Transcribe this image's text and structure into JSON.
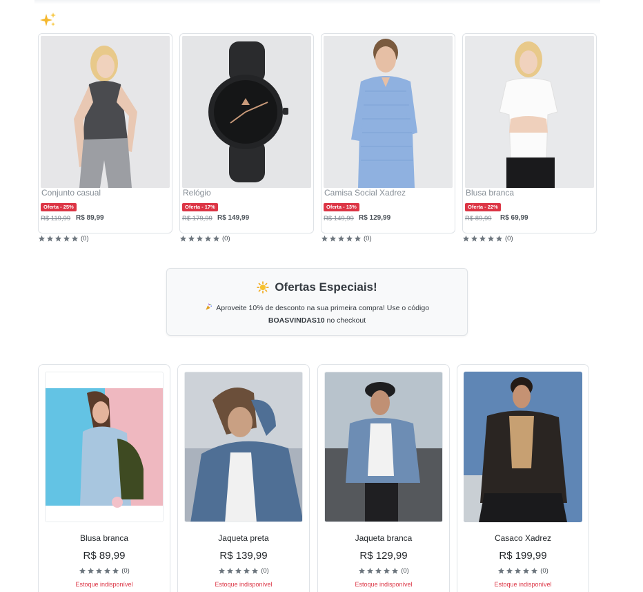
{
  "featured": [
    {
      "name": "Conjunto casual",
      "badge": "Oferta - 25%",
      "old_price": "R$ 119,99",
      "price": "R$ 89,99",
      "rating_count": "(0)"
    },
    {
      "name": "Relógio",
      "badge": "Oferta - 17%",
      "old_price": "R$ 179,99",
      "price": "R$ 149,99",
      "rating_count": "(0)"
    },
    {
      "name": "Camisa Social Xadrez",
      "badge": "Oferta - 13%",
      "old_price": "R$ 149,99",
      "price": "R$ 129,99",
      "rating_count": "(0)"
    },
    {
      "name": "Blusa branca",
      "badge": "Oferta - 22%",
      "old_price": "R$ 89,99",
      "price": "R$ 69,99",
      "rating_count": "(0)"
    }
  ],
  "promo": {
    "title": "Ofertas Especiais!",
    "text_before": "Aproveite 10% de desconto na sua primeira compra! Use o código",
    "code": "BOASVINDAS10",
    "text_after": "no checkout"
  },
  "products": [
    {
      "name": "Blusa branca",
      "price": "R$ 89,99",
      "rating_count": "(0)",
      "stock": "Estoque indisponível"
    },
    {
      "name": "Jaqueta preta",
      "price": "R$ 139,99",
      "rating_count": "(0)",
      "stock": "Estoque indisponível"
    },
    {
      "name": "Jaqueta branca",
      "price": "R$ 129,99",
      "rating_count": "(0)",
      "stock": "Estoque indisponível"
    },
    {
      "name": "Casaco Xadrez",
      "price": "R$ 199,99",
      "rating_count": "(0)",
      "stock": "Estoque indisponível"
    }
  ],
  "colors": {
    "badge": "#dc3545",
    "star": "#6c757d",
    "stock": "#dc3545",
    "border": "#dee2e6"
  },
  "icons": {
    "section": "sparkles-icon",
    "promo": "sun-icon",
    "promo_text": "party-popper-icon",
    "rating": "star-icon"
  }
}
